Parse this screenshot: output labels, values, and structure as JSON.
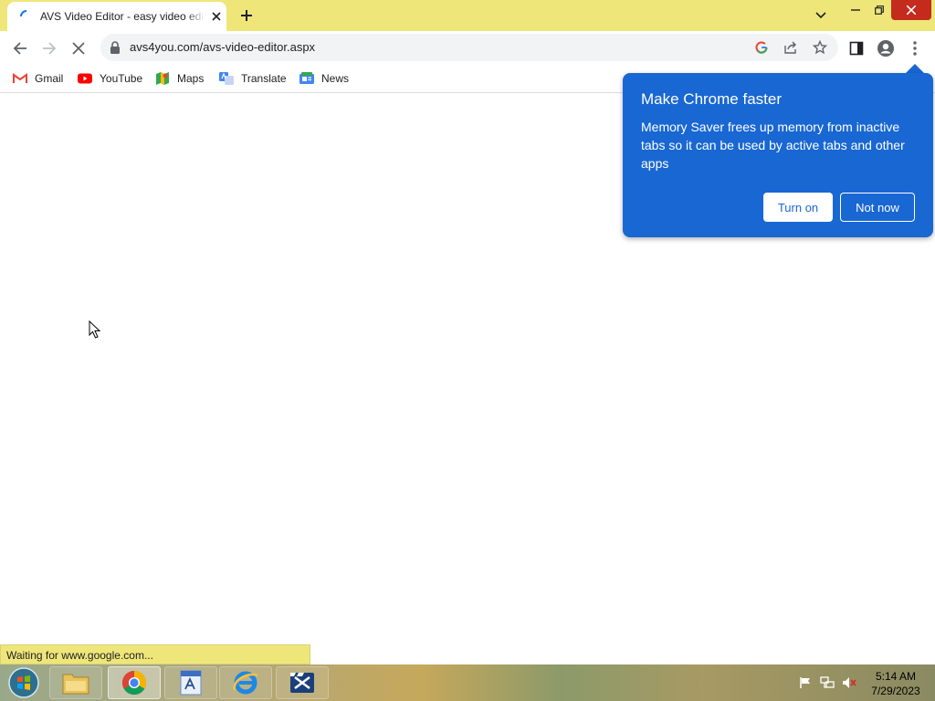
{
  "browser": {
    "tab_title": "AVS Video Editor - easy video editing",
    "url": "avs4you.com/avs-video-editor.aspx"
  },
  "bookmarks": [
    {
      "label": "Gmail",
      "icon": "gmail-icon"
    },
    {
      "label": "YouTube",
      "icon": "youtube-icon"
    },
    {
      "label": "Maps",
      "icon": "maps-icon"
    },
    {
      "label": "Translate",
      "icon": "translate-icon"
    },
    {
      "label": "News",
      "icon": "news-icon"
    }
  ],
  "popup": {
    "title": "Make Chrome faster",
    "body": "Memory Saver frees up memory from inactive tabs so it can be used by active tabs and other apps",
    "turn_on": "Turn on",
    "not_now": "Not now"
  },
  "status": {
    "text": "Waiting for www.google.com..."
  },
  "taskbar": {
    "time": "5:14 AM",
    "date": "7/29/2023"
  },
  "colors": {
    "chrome_frame": "#efe67a",
    "popup_blue": "#1967d2",
    "close_red": "#c42b1c"
  }
}
